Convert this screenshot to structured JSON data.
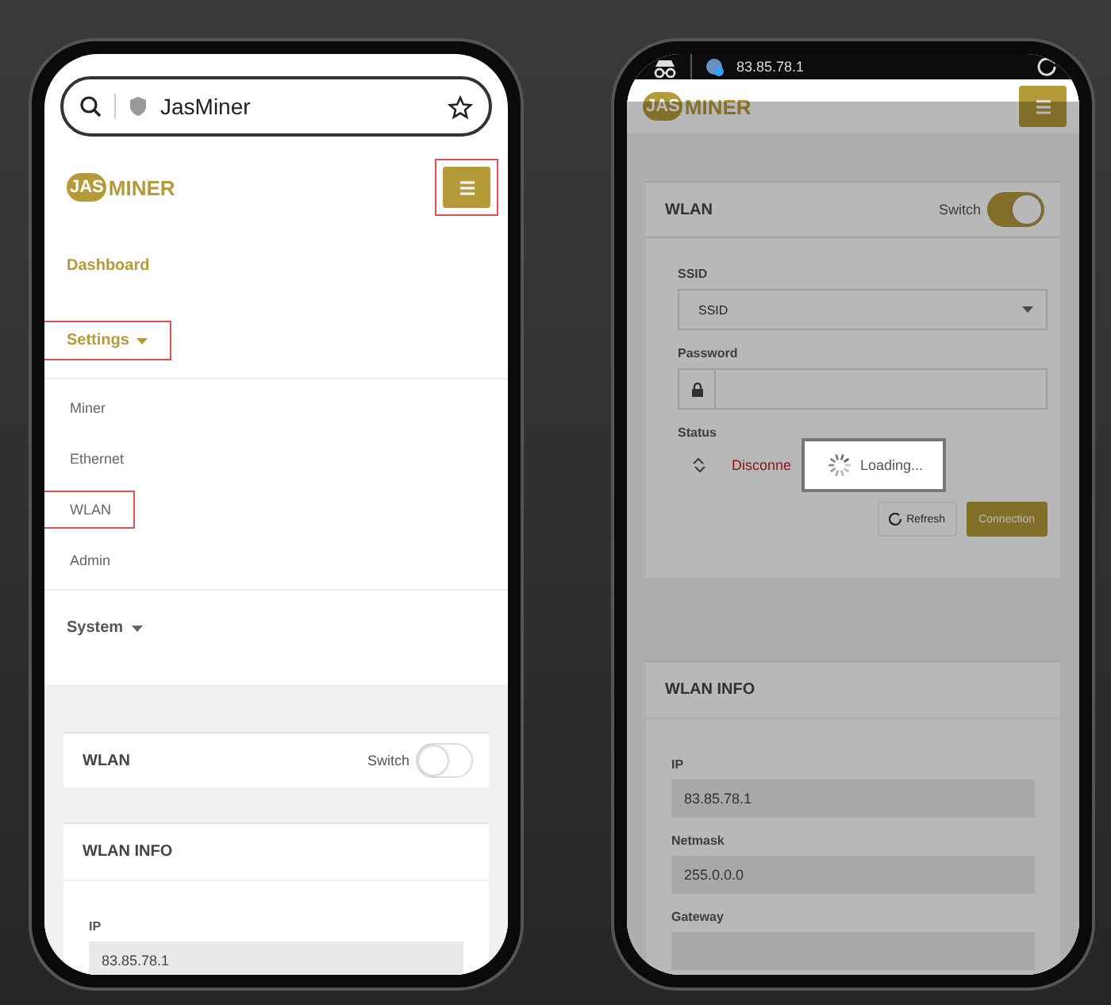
{
  "phones": [
    {
      "address_bar": {
        "kind": "light",
        "text": "JasMiner"
      },
      "sections": [
        {
          "kind": "header",
          "logo_mark": "JAS",
          "logo_word": "MINER",
          "menu_marked": true
        },
        {
          "kind": "nav",
          "items": [
            {
              "label": "Dashboard",
              "kind": "link",
              "active": true,
              "marked": false
            },
            {
              "label": "Settings",
              "kind": "dropdown",
              "active": true,
              "marked": true,
              "children": [
                {
                  "label": "Miner",
                  "marked": false
                },
                {
                  "label": "Ethernet",
                  "marked": false
                },
                {
                  "label": "WLAN",
                  "marked": true
                },
                {
                  "label": "Admin",
                  "marked": false
                }
              ]
            },
            {
              "label": "System",
              "kind": "dropdown",
              "active": false,
              "marked": false
            }
          ]
        },
        {
          "kind": "gap"
        },
        {
          "kind": "switch_card",
          "title": "WLAN",
          "switch_label": "Switch",
          "on": false
        },
        {
          "kind": "info_card",
          "title": "WLAN INFO",
          "fields": [
            {
              "label": "IP",
              "value": "83.85.78.1"
            }
          ]
        }
      ]
    },
    {
      "address_bar": {
        "kind": "dark",
        "text": "83.85.78.1"
      },
      "loading": {
        "text": "Loading..."
      },
      "sections": [
        {
          "kind": "header",
          "logo_mark": "JAS",
          "logo_word": "MINER",
          "menu_marked": false
        },
        {
          "kind": "gap"
        },
        {
          "kind": "switch_card",
          "title": "WLAN",
          "switch_label": "Switch",
          "on": true
        },
        {
          "kind": "wifi_form",
          "fields": [
            {
              "kind": "select",
              "label": "SSID",
              "value": "SSID"
            },
            {
              "kind": "password",
              "label": "Password"
            },
            {
              "kind": "status",
              "label": "Status",
              "value": "Disconne"
            }
          ],
          "buttons": [
            {
              "kind": "outline",
              "label": "Refresh"
            },
            {
              "kind": "primary",
              "label": "Connection"
            }
          ]
        },
        {
          "kind": "gap"
        },
        {
          "kind": "info_card",
          "title": "WLAN INFO",
          "fields": [
            {
              "label": "IP",
              "value": "83.85.78.1"
            },
            {
              "label": "Netmask",
              "value": "255.0.0.0"
            },
            {
              "label": "Gateway"
            }
          ]
        }
      ]
    }
  ]
}
